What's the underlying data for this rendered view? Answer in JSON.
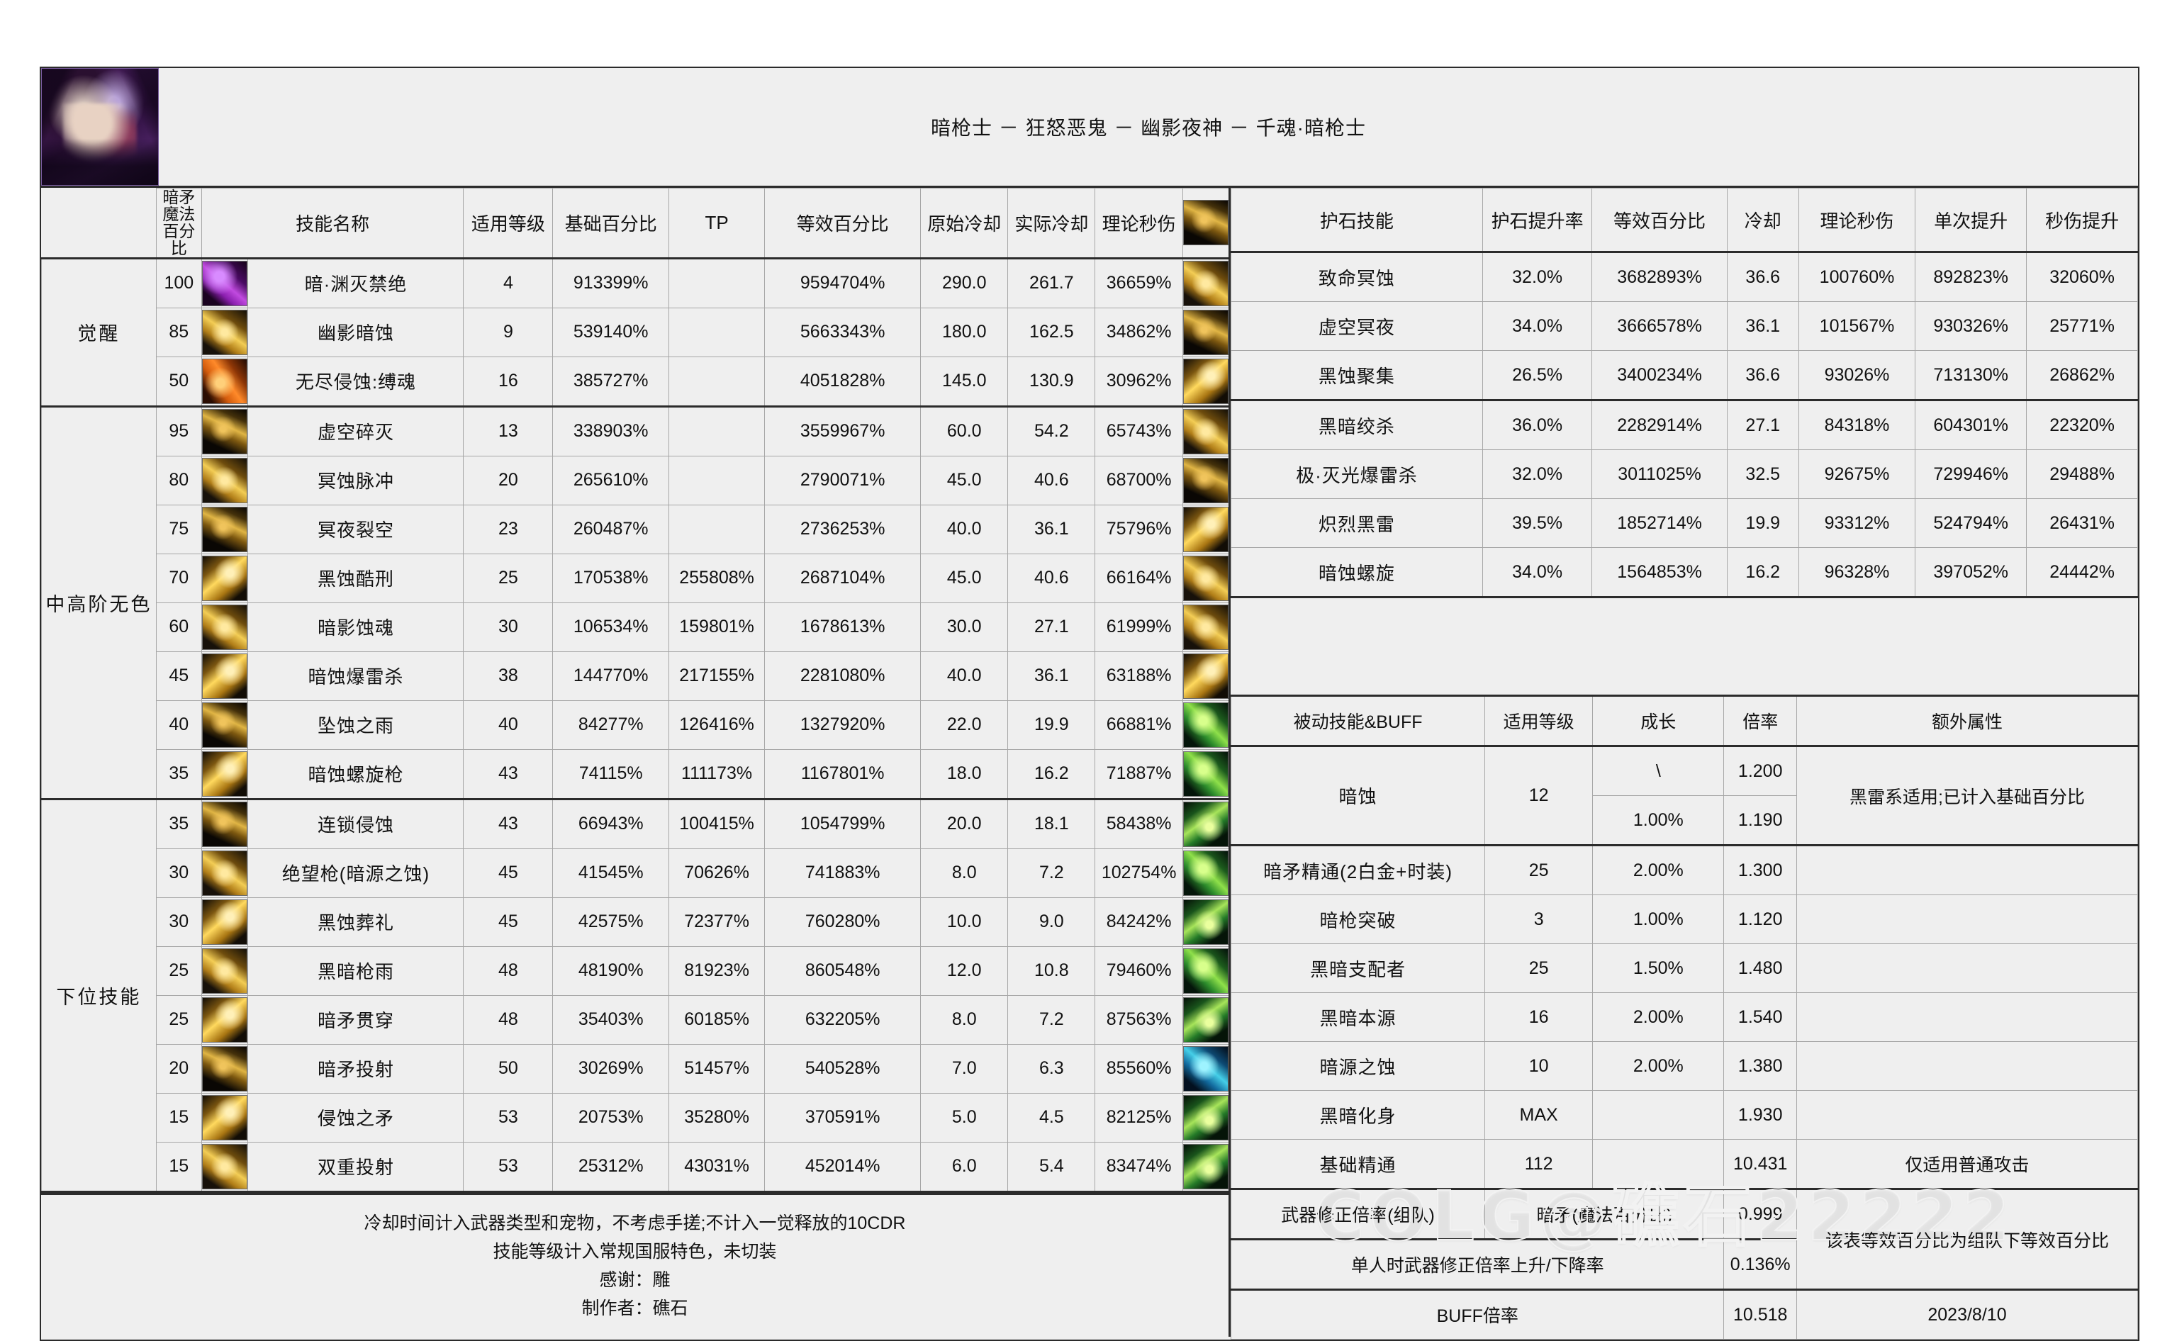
{
  "header": {
    "title": "暗枪士 － 狂怒恶鬼 － 幽影夜神 － 千魂·暗枪士",
    "portrait_alt": "暗枪士头像"
  },
  "left_table": {
    "columns": [
      "暗矛\n魔法百分比",
      "技能名称",
      "适用等级",
      "基础百分比",
      "TP",
      "等效百分比",
      "原始冷却",
      "实际冷却",
      "理论秒伤"
    ],
    "col_mp_line1": "暗矛",
    "col_mp_line2": "魔法百分比",
    "col_name": "技能名称",
    "col_level": "适用等级",
    "col_base": "基础百分比",
    "col_tp": "TP",
    "col_eq": "等效百分比",
    "col_cd_raw": "原始冷却",
    "col_cd_real": "实际冷却",
    "col_dps": "理论秒伤",
    "groups": [
      {
        "label": "觉醒",
        "rows": [
          {
            "mp": "100",
            "icon": "ic-purple",
            "name": "暗·渊灭禁绝",
            "level": "4",
            "base": "913399%",
            "tp": "",
            "eq": "9594704%",
            "cd_raw": "290.0",
            "cd_real": "261.7",
            "dps": "36659%"
          },
          {
            "mp": "85",
            "icon": "ic-gold",
            "name": "幽影暗蚀",
            "level": "9",
            "base": "539140%",
            "tp": "",
            "eq": "5663343%",
            "cd_raw": "180.0",
            "cd_real": "162.5",
            "dps": "34862%"
          },
          {
            "mp": "50",
            "icon": "ic-orange",
            "name": "无尽侵蚀:缚魂",
            "level": "16",
            "base": "385727%",
            "tp": "",
            "eq": "4051828%",
            "cd_raw": "145.0",
            "cd_real": "130.9",
            "dps": "30962%"
          }
        ]
      },
      {
        "label": "中高阶无色",
        "rows": [
          {
            "mp": "95",
            "icon": "ic-dark",
            "name": "虚空碎灭",
            "level": "13",
            "base": "338903%",
            "tp": "",
            "eq": "3559967%",
            "cd_raw": "60.0",
            "cd_real": "54.2",
            "dps": "65743%"
          },
          {
            "mp": "80",
            "icon": "ic-gold",
            "name": "冥蚀脉冲",
            "level": "20",
            "base": "265610%",
            "tp": "",
            "eq": "2790071%",
            "cd_raw": "45.0",
            "cd_real": "40.6",
            "dps": "68700%"
          },
          {
            "mp": "75",
            "icon": "ic-dark",
            "name": "冥夜裂空",
            "level": "23",
            "base": "260487%",
            "tp": "",
            "eq": "2736253%",
            "cd_raw": "40.0",
            "cd_real": "36.1",
            "dps": "75796%"
          },
          {
            "mp": "70",
            "icon": "ic-gold2",
            "name": "黑蚀酷刑",
            "level": "25",
            "base": "170538%",
            "tp": "255808%",
            "eq": "2687104%",
            "cd_raw": "45.0",
            "cd_real": "40.6",
            "dps": "66164%"
          },
          {
            "mp": "60",
            "icon": "ic-gold",
            "name": "暗影蚀魂",
            "level": "30",
            "base": "106534%",
            "tp": "159801%",
            "eq": "1678613%",
            "cd_raw": "30.0",
            "cd_real": "27.1",
            "dps": "61999%"
          },
          {
            "mp": "45",
            "icon": "ic-gold2",
            "name": "暗蚀爆雷杀",
            "level": "38",
            "base": "144770%",
            "tp": "217155%",
            "eq": "2281080%",
            "cd_raw": "40.0",
            "cd_real": "36.1",
            "dps": "63188%"
          },
          {
            "mp": "40",
            "icon": "ic-dark",
            "name": "坠蚀之雨",
            "level": "40",
            "base": "84277%",
            "tp": "126416%",
            "eq": "1327920%",
            "cd_raw": "22.0",
            "cd_real": "19.9",
            "dps": "66881%"
          },
          {
            "mp": "35",
            "icon": "ic-gold2",
            "name": "暗蚀螺旋枪",
            "level": "43",
            "base": "74115%",
            "tp": "111173%",
            "eq": "1167801%",
            "cd_raw": "18.0",
            "cd_real": "16.2",
            "dps": "71887%"
          }
        ]
      },
      {
        "label": "下位技能",
        "rows": [
          {
            "mp": "35",
            "icon": "ic-dark",
            "name": "连锁侵蚀",
            "level": "43",
            "base": "66943%",
            "tp": "100415%",
            "eq": "1054799%",
            "cd_raw": "20.0",
            "cd_real": "18.1",
            "dps": "58438%"
          },
          {
            "mp": "30",
            "icon": "ic-gold",
            "name": "绝望枪(暗源之蚀)",
            "level": "45",
            "base": "41545%",
            "tp": "70626%",
            "eq": "741883%",
            "cd_raw": "8.0",
            "cd_real": "7.2",
            "dps": "102754%"
          },
          {
            "mp": "30",
            "icon": "ic-gold2",
            "name": "黑蚀葬礼",
            "level": "45",
            "base": "42575%",
            "tp": "72377%",
            "eq": "760280%",
            "cd_raw": "10.0",
            "cd_real": "9.0",
            "dps": "84242%"
          },
          {
            "mp": "25",
            "icon": "ic-gold",
            "name": "黑暗枪雨",
            "level": "48",
            "base": "48190%",
            "tp": "81923%",
            "eq": "860548%",
            "cd_raw": "12.0",
            "cd_real": "10.8",
            "dps": "79460%"
          },
          {
            "mp": "25",
            "icon": "ic-gold2",
            "name": "暗矛贯穿",
            "level": "48",
            "base": "35403%",
            "tp": "60185%",
            "eq": "632205%",
            "cd_raw": "8.0",
            "cd_real": "7.2",
            "dps": "87563%"
          },
          {
            "mp": "20",
            "icon": "ic-dark",
            "name": "暗矛投射",
            "level": "50",
            "base": "30269%",
            "tp": "51457%",
            "eq": "540528%",
            "cd_raw": "7.0",
            "cd_real": "6.3",
            "dps": "85560%"
          },
          {
            "mp": "15",
            "icon": "ic-gold2",
            "name": "侵蚀之矛",
            "level": "53",
            "base": "20753%",
            "tp": "35280%",
            "eq": "370591%",
            "cd_raw": "5.0",
            "cd_real": "4.5",
            "dps": "82125%"
          },
          {
            "mp": "15",
            "icon": "ic-gold",
            "name": "双重投射",
            "level": "53",
            "base": "25312%",
            "tp": "43031%",
            "eq": "452014%",
            "cd_raw": "6.0",
            "cd_real": "5.4",
            "dps": "83474%"
          }
        ]
      }
    ]
  },
  "rune_table": {
    "col_name": "护石技能",
    "col_rate": "护石提升率",
    "col_eq": "等效百分比",
    "col_cd": "冷却",
    "col_dps": "理论秒伤",
    "col_up_single": "单次提升",
    "col_up_dps": "秒伤提升",
    "rows": [
      {
        "icon": "ic-gold",
        "name": "致命冥蚀",
        "rate": "32.0%",
        "eq": "3682893%",
        "cd": "36.6",
        "dps": "100760%",
        "up1": "892823%",
        "up2": "32060%"
      },
      {
        "icon": "ic-dark",
        "name": "虚空冥夜",
        "rate": "34.0%",
        "eq": "3666578%",
        "cd": "36.1",
        "dps": "101567%",
        "up1": "930326%",
        "up2": "25771%"
      },
      {
        "icon": "ic-gold2",
        "name": "黑蚀聚集",
        "rate": "26.5%",
        "eq": "3400234%",
        "cd": "36.6",
        "dps": "93026%",
        "up1": "713130%",
        "up2": "26862%"
      },
      {
        "icon": "ic-gold",
        "name": "黑暗绞杀",
        "rate": "36.0%",
        "eq": "2282914%",
        "cd": "27.1",
        "dps": "84318%",
        "up1": "604301%",
        "up2": "22320%"
      },
      {
        "icon": "ic-dark",
        "name": "极·灭光爆雷杀",
        "rate": "32.0%",
        "eq": "3011025%",
        "cd": "32.5",
        "dps": "92675%",
        "up1": "729946%",
        "up2": "29488%"
      },
      {
        "icon": "ic-gold2",
        "name": "炽烈黑雷",
        "rate": "39.5%",
        "eq": "1852714%",
        "cd": "19.9",
        "dps": "93312%",
        "up1": "524794%",
        "up2": "26431%"
      },
      {
        "icon": "ic-gold",
        "name": "暗蚀螺旋",
        "rate": "34.0%",
        "eq": "1564853%",
        "cd": "16.2",
        "dps": "96328%",
        "up1": "397052%",
        "up2": "24442%"
      }
    ]
  },
  "passive_table": {
    "col_name": "被动技能&BUFF",
    "col_level": "适用等级",
    "col_growth": "成长",
    "col_mult": "倍率",
    "col_extra": "额外属性",
    "rows": [
      {
        "icon": "ic-green",
        "name": "暗蚀",
        "level": "12",
        "growth": "\\",
        "mult": "1.200",
        "extra": "黑雷系适用;已计入基础百分比",
        "rowspan": 2
      },
      {
        "icon": "ic-blank",
        "name": "",
        "level": "",
        "growth": "1.00%",
        "mult": "1.190",
        "extra": ""
      },
      {
        "icon": "ic-green",
        "name": "暗矛精通(2白金+时装)",
        "level": "25",
        "growth": "2.00%",
        "mult": "1.300",
        "extra": ""
      },
      {
        "icon": "ic-green2",
        "name": "暗枪突破",
        "level": "3",
        "growth": "1.00%",
        "mult": "1.120",
        "extra": ""
      },
      {
        "icon": "ic-green",
        "name": "黑暗支配者",
        "level": "25",
        "growth": "1.50%",
        "mult": "1.480",
        "extra": ""
      },
      {
        "icon": "ic-green2",
        "name": "黑暗本源",
        "level": "16",
        "growth": "2.00%",
        "mult": "1.540",
        "extra": ""
      },
      {
        "icon": "ic-green",
        "name": "暗源之蚀",
        "level": "10",
        "growth": "2.00%",
        "mult": "1.380",
        "extra": ""
      },
      {
        "icon": "ic-blue",
        "name": "黑暗化身",
        "level": "MAX",
        "growth": "",
        "mult": "1.930",
        "extra": ""
      },
      {
        "icon": "ic-green2",
        "name": "基础精通",
        "level": "112",
        "growth": "",
        "mult": "10.431",
        "extra": "仅适用普通攻击"
      }
    ]
  },
  "summary_table": {
    "rows": [
      {
        "label": "武器修正倍率(组队)",
        "value": "暗矛(魔法百分比)",
        "mult": "0.999"
      },
      {
        "label": "单人时武器修正倍率上升/下降率",
        "value": "",
        "mult": "0.136%"
      },
      {
        "label": "BUFF倍率",
        "value": "",
        "mult": "10.518"
      }
    ],
    "note": "该表等效百分比为组队下等效百分比",
    "date": "2023/8/10"
  },
  "footer": {
    "line1": "冷却时间计入武器类型和宠物，不考虑手搓;不计入一觉释放的10CDR",
    "line2": "技能等级计入常规国服特色，未切装",
    "line3": "感谢：雕",
    "line4": "制作者：礁石"
  },
  "watermark": "COLG@礁石22222"
}
